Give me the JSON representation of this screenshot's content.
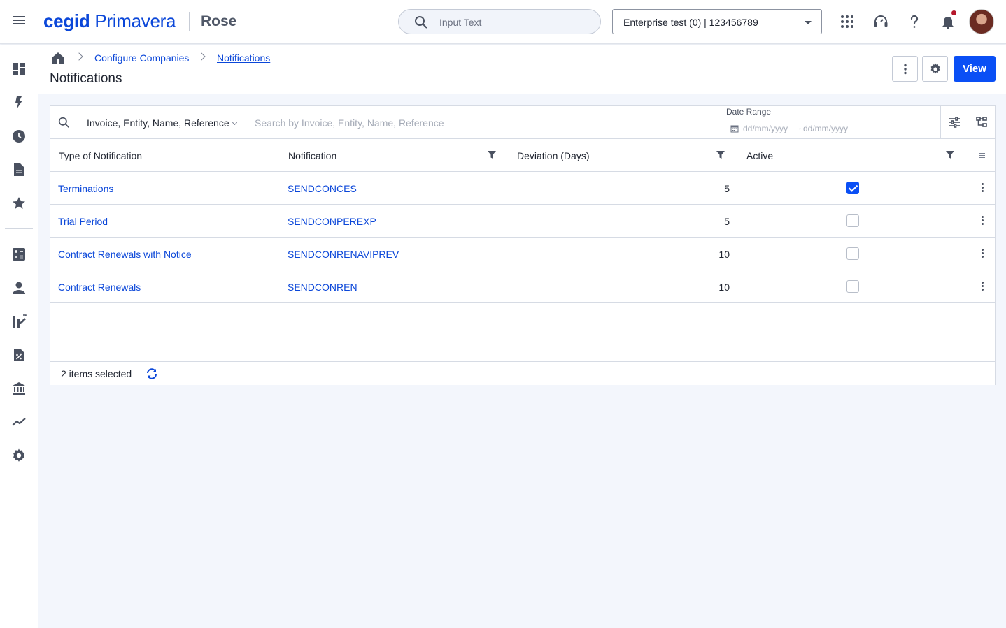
{
  "topbar": {
    "logo_primary": "cegid",
    "logo_secondary": "Primavera",
    "company": "Rose",
    "search_placeholder": "Input Text",
    "enterprise_selected": "Enterprise test (0) | 123456789"
  },
  "icons": {
    "menu": "hamburger-menu-icon",
    "search": "search-icon",
    "apps": "apps-grid-icon",
    "support": "headset-icon",
    "help": "help-icon",
    "notifications": "bell-icon"
  },
  "sidebar": {
    "items": [
      {
        "icon": "dashboard-icon"
      },
      {
        "icon": "lightning-icon"
      },
      {
        "icon": "clock-icon"
      },
      {
        "icon": "document-icon"
      },
      {
        "icon": "star-icon"
      },
      {
        "icon": "calculator-icon"
      },
      {
        "icon": "person-icon"
      },
      {
        "icon": "edit-list-icon"
      },
      {
        "icon": "percent-document-icon"
      },
      {
        "icon": "bank-icon"
      },
      {
        "icon": "trending-icon"
      },
      {
        "icon": "settings-icon"
      }
    ]
  },
  "breadcrumb": {
    "items": [
      "Configure Companies",
      "Notifications"
    ]
  },
  "page": {
    "title": "Notifications",
    "view_button": "View"
  },
  "filter": {
    "field_selector": "Invoice, Entity, Name, Reference",
    "search_placeholder": "Search by Invoice, Entity, Name, Reference",
    "date_range_label": "Date Range",
    "date_from_placeholder": "dd/mm/yyyy",
    "date_arrow": "→",
    "date_to_placeholder": "dd/mm/yyyy"
  },
  "table": {
    "columns": [
      "Type of Notification",
      "Notification",
      "Deviation (Days)",
      "Active"
    ],
    "rows": [
      {
        "type": "Terminations",
        "notification": "SENDCONCES",
        "deviation": "5",
        "active": true
      },
      {
        "type": "Trial Period",
        "notification": "SENDCONPEREXP",
        "deviation": "5",
        "active": false
      },
      {
        "type": "Contract Renewals with Notice",
        "notification": "SENDCONRENAVIPREV",
        "deviation": "10",
        "active": false
      },
      {
        "type": "Contract Renewals",
        "notification": "SENDCONREN",
        "deviation": "10",
        "active": false
      }
    ]
  },
  "footer": {
    "selected_text": "2 items selected"
  },
  "colors": {
    "brand": "#0b47d9",
    "primary_button": "#0a4ff5",
    "notification_dot": "#b5172b",
    "background": "#f3f6fc"
  }
}
